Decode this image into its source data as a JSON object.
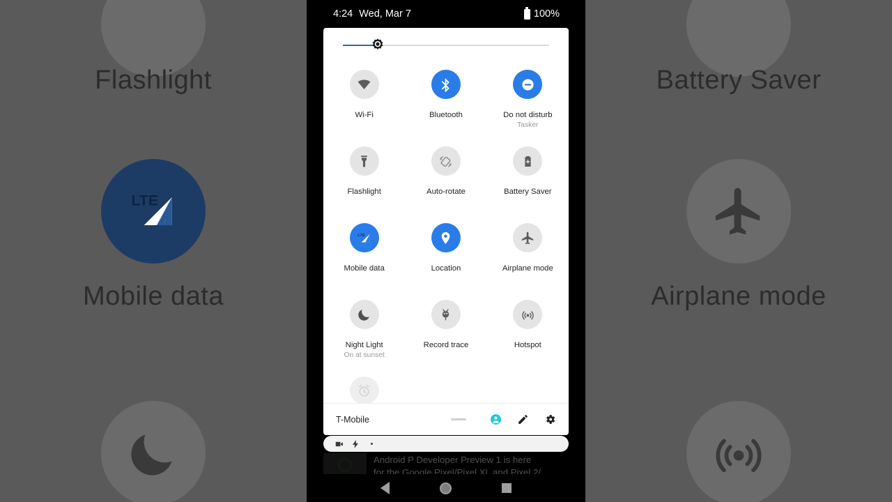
{
  "statusbar": {
    "time": "4:24",
    "date": "Wed, Mar 7",
    "battery_percent": "100%",
    "battery_icon": "battery-full-icon"
  },
  "brightness": {
    "label": "Brightness slider",
    "value_percent": 17,
    "fill_color": "#3b5fb5",
    "track_color": "#dadada",
    "thumb_icon": "brightness-gear-icon"
  },
  "quick_settings": {
    "accent_on_color": "#2a7ce8",
    "off_color": "#e4e4e4",
    "rows": [
      [
        {
          "label": "Wi-Fi",
          "sub": "",
          "icon": "wifi-icon",
          "state": "off"
        },
        {
          "label": "Bluetooth",
          "sub": "",
          "icon": "bluetooth-icon",
          "state": "on"
        },
        {
          "label": "Do not disturb",
          "sub": "Tasker",
          "icon": "do-not-disturb-icon",
          "state": "on"
        }
      ],
      [
        {
          "label": "Flashlight",
          "sub": "",
          "icon": "flashlight-icon",
          "state": "off"
        },
        {
          "label": "Auto-rotate",
          "sub": "",
          "icon": "auto-rotate-icon",
          "state": "off"
        },
        {
          "label": "Battery Saver",
          "sub": "",
          "icon": "battery-saver-icon",
          "state": "off"
        }
      ],
      [
        {
          "label": "Mobile data",
          "sub": "",
          "icon": "mobile-data-lte-icon",
          "state": "on"
        },
        {
          "label": "Location",
          "sub": "",
          "icon": "location-pin-icon",
          "state": "on"
        },
        {
          "label": "Airplane mode",
          "sub": "",
          "icon": "airplane-icon",
          "state": "off"
        }
      ],
      [
        {
          "label": "Night Light",
          "sub": "On at sunset",
          "icon": "moon-icon",
          "state": "off"
        },
        {
          "label": "Record trace",
          "sub": "",
          "icon": "bug-icon",
          "state": "off"
        },
        {
          "label": "Hotspot",
          "sub": "",
          "icon": "hotspot-icon",
          "state": "off"
        }
      ]
    ],
    "partial_row": [
      {
        "label": "",
        "sub": "",
        "icon": "alarm-clock-icon",
        "state": "off"
      }
    ]
  },
  "footer": {
    "carrier": "T-Mobile",
    "drag_handle": "drag-handle",
    "user_icon": "user-avatar-icon",
    "user_icon_color": "#1ec8e0",
    "edit_icon": "pencil-edit-icon",
    "settings_icon": "gear-settings-icon"
  },
  "notification_strip": {
    "icons": [
      "video-camera-icon",
      "lightning-bolt-icon"
    ],
    "dot": "status-dot"
  },
  "notification_card": {
    "thumb": "notification-thumbnail",
    "line1": "Android P Developer Preview 1 is here",
    "line2": "for the Google Pixel/Pixel XL and Pixel 2/"
  },
  "navbar": {
    "back": "back-nav-button",
    "home": "home-nav-button",
    "recents": "recents-nav-button"
  },
  "backdrop": {
    "left_tiles": [
      {
        "label": "Flashlight",
        "icon": "flashlight-icon",
        "state": "off"
      },
      {
        "label": "Mobile data",
        "icon": "mobile-data-lte-icon",
        "state": "on"
      },
      {
        "label": "",
        "icon": "moon-icon",
        "state": "off"
      }
    ],
    "right_tiles": [
      {
        "label": "Battery Saver",
        "icon": "battery-saver-icon",
        "state": "off"
      },
      {
        "label": "Airplane mode",
        "icon": "airplane-icon",
        "state": "off"
      },
      {
        "label": "",
        "icon": "hotspot-icon",
        "state": "off"
      }
    ]
  }
}
